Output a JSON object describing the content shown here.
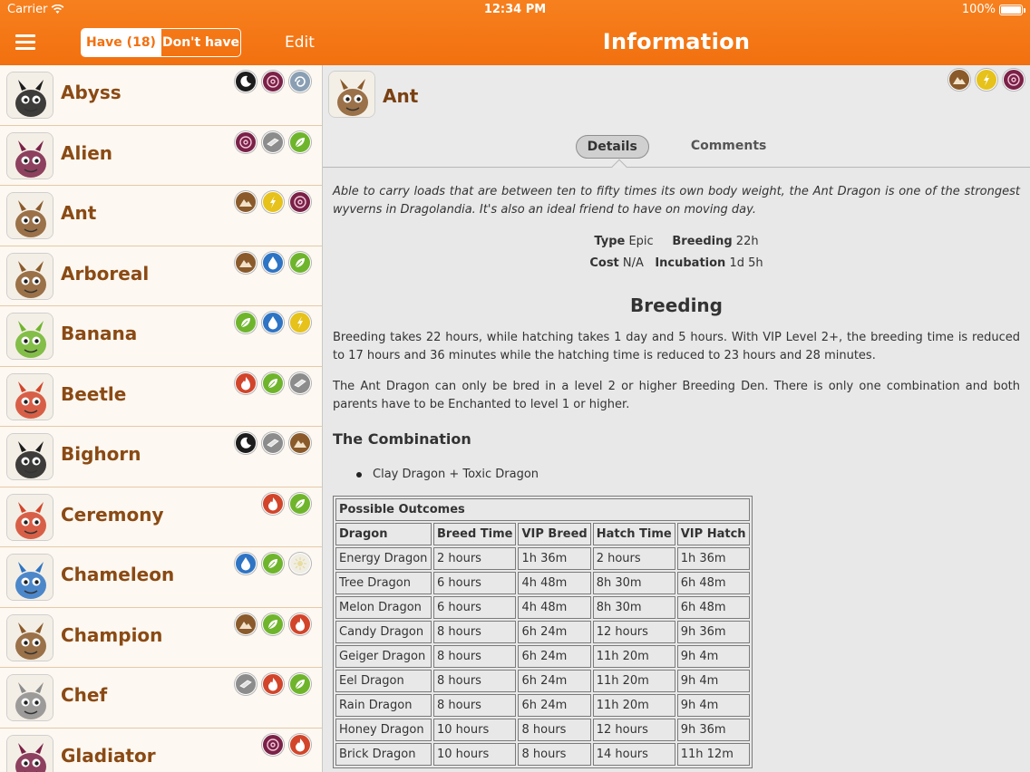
{
  "status_bar": {
    "carrier": "Carrier",
    "time": "12:34 PM",
    "battery": "100%"
  },
  "header": {
    "segment_have": "Have (18)",
    "segment_dont_have": "Don't have",
    "edit_label": "Edit",
    "title": "Information"
  },
  "dragons": [
    {
      "name": "Abyss",
      "elements": [
        "dark-icon",
        "magic-icon",
        "wind-icon"
      ]
    },
    {
      "name": "Alien",
      "elements": [
        "magic-icon",
        "metal-icon",
        "nature-icon"
      ]
    },
    {
      "name": "Ant",
      "elements": [
        "terra-icon",
        "electric-icon",
        "magic-icon"
      ]
    },
    {
      "name": "Arboreal",
      "elements": [
        "terra-icon",
        "water-icon",
        "nature-icon"
      ]
    },
    {
      "name": "Banana",
      "elements": [
        "nature-icon",
        "water-icon",
        "electric-icon"
      ]
    },
    {
      "name": "Beetle",
      "elements": [
        "fire-icon",
        "nature-icon",
        "metal-icon"
      ]
    },
    {
      "name": "Bighorn",
      "elements": [
        "dark-icon",
        "metal-icon",
        "terra-icon"
      ]
    },
    {
      "name": "Ceremony",
      "elements": [
        "fire-icon",
        "nature-icon"
      ]
    },
    {
      "name": "Chameleon",
      "elements": [
        "water-icon",
        "nature-icon",
        "light-icon"
      ]
    },
    {
      "name": "Champion",
      "elements": [
        "terra-icon",
        "nature-icon",
        "fire-icon"
      ]
    },
    {
      "name": "Chef",
      "elements": [
        "metal-icon",
        "fire-icon",
        "nature-icon"
      ]
    },
    {
      "name": "Gladiator",
      "elements": [
        "magic-icon",
        "fire-icon"
      ]
    }
  ],
  "detail": {
    "name": "Ant",
    "elements": [
      "terra-icon",
      "electric-icon",
      "magic-icon"
    ],
    "tabs": [
      "Details",
      "Comments"
    ],
    "description": "Able to carry loads that are between ten to fifty times its own body weight, the Ant Dragon is one of the strongest wyverns in Dragolandia. It's also an ideal friend to have on moving day.",
    "stats": {
      "type_label": "Type",
      "type_value": "Epic",
      "breeding_label": "Breeding",
      "breeding_value": "22h",
      "cost_label": "Cost",
      "cost_value": "N/A",
      "incubation_label": "Incubation",
      "incubation_value": "1d 5h"
    },
    "breeding_heading": "Breeding",
    "breeding_para1": "Breeding takes 22 hours, while hatching takes 1 day and 5 hours. With VIP Level 2+, the breeding time is reduced to 17 hours and 36 minutes while the hatching time is reduced to 23 hours and 28 minutes.",
    "breeding_para2": "The Ant Dragon can only be bred in a level 2 or higher Breeding Den. There is only one combination and both parents have to be Enchanted to level 1 or higher.",
    "combination_heading": "The Combination",
    "combination_item": "Clay Dragon + Toxic Dragon",
    "outcomes": {
      "caption": "Possible Outcomes",
      "headers": [
        "Dragon",
        "Breed Time",
        "VIP Breed",
        "Hatch Time",
        "VIP Hatch"
      ],
      "rows": [
        [
          "Energy Dragon",
          "2 hours",
          "1h 36m",
          "2 hours",
          "1h 36m"
        ],
        [
          "Tree Dragon",
          "6 hours",
          "4h 48m",
          "8h 30m",
          "6h 48m"
        ],
        [
          "Melon Dragon",
          "6 hours",
          "4h 48m",
          "8h 30m",
          "6h 48m"
        ],
        [
          "Candy Dragon",
          "8 hours",
          "6h 24m",
          "12 hours",
          "9h 36m"
        ],
        [
          "Geiger Dragon",
          "8 hours",
          "6h 24m",
          "11h 20m",
          "9h 4m"
        ],
        [
          "Eel Dragon",
          "8 hours",
          "6h 24m",
          "11h 20m",
          "9h 4m"
        ],
        [
          "Rain Dragon",
          "8 hours",
          "6h 24m",
          "11h 20m",
          "9h 4m"
        ],
        [
          "Honey Dragon",
          "10 hours",
          "8 hours",
          "12 hours",
          "9h 36m"
        ],
        [
          "Brick Dragon",
          "10 hours",
          "8 hours",
          "14 hours",
          "11h 12m"
        ]
      ]
    }
  },
  "colors": {
    "accent": "#f2700f",
    "name_brown": "#8a4a14",
    "element_dark": "#1c1c1c",
    "element_magic": "#7b2147",
    "element_wind": "#8a9fb3",
    "element_metal": "#8c8c8c",
    "element_nature": "#6fb52c",
    "element_terra": "#8a5a2b",
    "element_electric": "#e6c21a",
    "element_water": "#2e74c4",
    "element_fire": "#d2452a",
    "element_light": "#f0eee4"
  }
}
